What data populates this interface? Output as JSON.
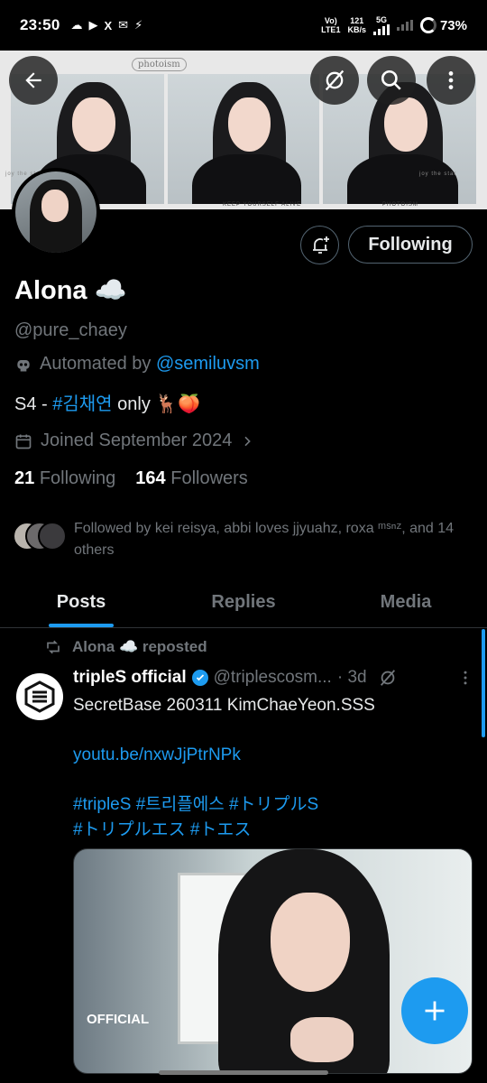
{
  "status_bar": {
    "time": "23:50",
    "apps": [
      "☁",
      "▶",
      "X",
      "✉",
      "⚡"
    ],
    "network_left_top": "Vo)",
    "network_left_bottom": "LTE1",
    "speed_top": "121",
    "speed_bottom": "KB/s",
    "network_5g": "5G",
    "battery": "73%"
  },
  "banner": {
    "logo_text": "photoism",
    "labels": [
      "joy the star",
      "KEEP YOURSELF ALIVE",
      "PHOTOISM",
      "joy the star"
    ]
  },
  "profile": {
    "name": "Alona ☁️",
    "handle": "@pure_chaey",
    "automated_prefix": "Automated by ",
    "automated_link": "@semiluvsm",
    "bio_prefix": "S4 - ",
    "bio_hashtag": "#김채연",
    "bio_suffix": " only 🦌🍑",
    "joined": "Joined September 2024",
    "following_count": "21",
    "following_label": "Following",
    "followers_count": "164",
    "followers_label": "Followers",
    "followed_by": "Followed by kei reisya, abbi loves jjyuahz, roxa ᵐˢⁿᶻ, and 14 others",
    "follow_button": "Following"
  },
  "tabs": [
    {
      "label": "Posts",
      "active": true
    },
    {
      "label": "Replies",
      "active": false
    },
    {
      "label": "Media",
      "active": false
    }
  ],
  "post": {
    "repost_label": "Alona ☁️ reposted",
    "author_name": "tripleS official",
    "author_handle": "@triplescosm...",
    "time": "· 3d",
    "text_line1": "SecretBase 260311 KimChaeYeon.SSS",
    "link": "youtu.be/nxwJjPtrNPk",
    "hashtags_line1": "#tripleS #트리플에스 #トリプルS",
    "hashtags_line2": "#トリプルエス #トエス",
    "media_logo": "OFFICIAL"
  },
  "colors": {
    "accent": "#1d9bf0",
    "background": "#000000",
    "secondary_text": "#71767b"
  }
}
